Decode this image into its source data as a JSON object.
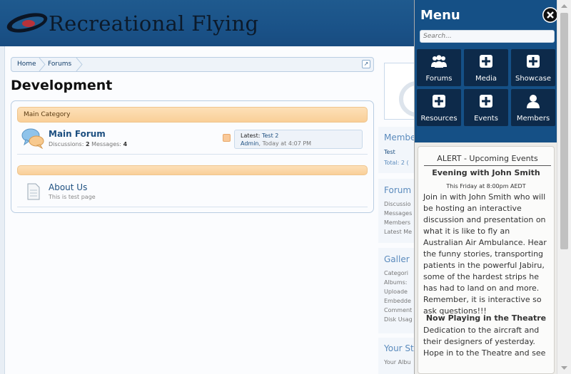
{
  "site": {
    "title": "Recreational Flying"
  },
  "breadcrumb": {
    "items": [
      "Home",
      "Forums"
    ]
  },
  "page": {
    "title": "Development"
  },
  "nodes": {
    "category1": "Main Category",
    "forum": {
      "title": "Main Forum",
      "discussions_label": "Discussions:",
      "discussions": "2",
      "messages_label": "Messages:",
      "messages": "4",
      "latest_label": "Latest:",
      "latest_thread": "Test 2",
      "latest_user": "Admin",
      "latest_time": ", Today at 4:07 PM"
    },
    "page": {
      "title": "About Us",
      "desc": "This is test page"
    }
  },
  "sidebar": {
    "members_head": "Membe",
    "member_1": "Test",
    "members_total": "Total: 2 (",
    "forum_head": "Forum",
    "forum_lines": [
      "Discussio",
      "Messages",
      "Members",
      "Latest Me"
    ],
    "gallery_head": "Galler",
    "gallery_lines": [
      "Categori",
      "Albums:",
      "Uploade",
      "Embedde",
      "Comment",
      "Disk Usag"
    ],
    "your_head": "Your St",
    "your_line": "Your Albu"
  },
  "menu": {
    "heading": "Menu",
    "search_placeholder": "Search...",
    "tiles": [
      {
        "label": "Forums",
        "icon": "users-icon"
      },
      {
        "label": "Media",
        "icon": "plus-icon"
      },
      {
        "label": "Showcase",
        "icon": "plus-icon"
      },
      {
        "label": "Resources",
        "icon": "plus-icon"
      },
      {
        "label": "Events",
        "icon": "plus-icon"
      },
      {
        "label": "Members",
        "icon": "user-icon"
      }
    ],
    "events": {
      "header": "ALERT - Upcoming Events",
      "title": "Evening with John Smith",
      "when": "This Friday at 8:00pm AEDT",
      "body": "Join in with John Smith who will be hosting an interactive discussion and presentation on what it is like to fly an Australian Air Ambulance. Hear the funny stories, transporting patients in the powerful Jabiru, some of the hardest strips he has had to land on and more. Remember, it is interactive so ask questions!!!",
      "theatre_title": "Now Playing in the Theatre",
      "theatre_body": "Dedication to the aircraft and their designers of yesterday. Hope in to the Theatre and see"
    }
  },
  "colors": {
    "header": "#1a5288",
    "menu": "#155086",
    "tile": "#0d2a4a",
    "category": "#f9cf98"
  }
}
